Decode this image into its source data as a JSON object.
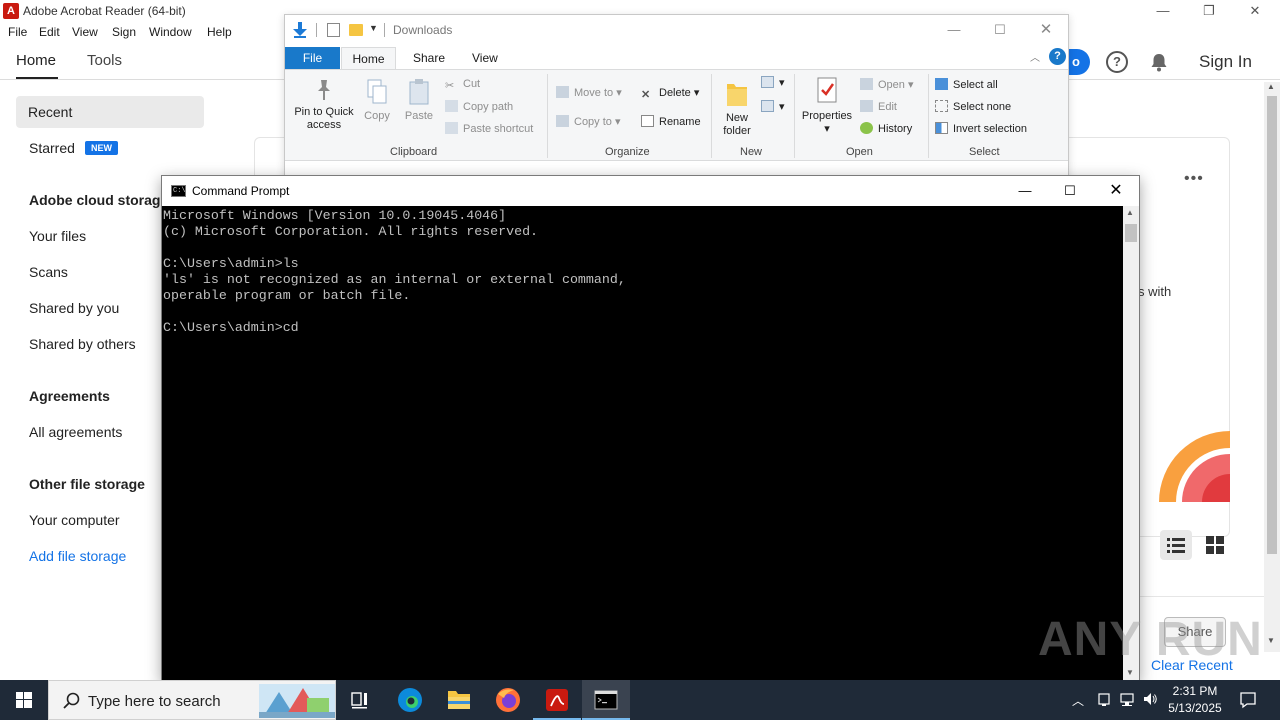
{
  "acrobat": {
    "title": "Adobe Acrobat Reader (64-bit)",
    "menu": [
      "File",
      "Edit",
      "View",
      "Sign",
      "Window",
      "Help"
    ],
    "tabs": {
      "home": "Home",
      "tools": "Tools"
    },
    "header": {
      "blue_button_fragment": "o",
      "help_glyph": "?",
      "sign_in": "Sign In"
    },
    "sidebar": {
      "recent": "Recent",
      "starred": "Starred",
      "new_badge": "NEW",
      "cloud_heading": "Adobe cloud storag",
      "your_files": "Your files",
      "scans": "Scans",
      "shared_by_you": "Shared by you",
      "shared_by_others": "Shared by others",
      "agreements_heading": "Agreements",
      "all_agreements": "All agreements",
      "other_heading": "Other file storage",
      "your_computer": "Your computer",
      "add_file_storage": "Add file storage"
    },
    "main": {
      "more": "•••",
      "with_fragment": "s with",
      "share": "Share",
      "clear_recent": "Clear Recent"
    },
    "colors": {
      "accent": "#1473e6",
      "brand_red": "#c91a10"
    }
  },
  "explorer": {
    "title": "Downloads",
    "tabs": {
      "file": "File",
      "home": "Home",
      "share": "Share",
      "view": "View"
    },
    "help_glyph": "?",
    "ribbon": {
      "clipboard": {
        "label": "Clipboard",
        "pin": "Pin to Quick access",
        "copy": "Copy",
        "paste": "Paste",
        "cut": "Cut",
        "copy_path": "Copy path",
        "paste_shortcut": "Paste shortcut"
      },
      "organize": {
        "label": "Organize",
        "move_to": "Move to",
        "copy_to": "Copy to",
        "delete": "Delete",
        "rename": "Rename"
      },
      "new": {
        "label": "New",
        "new_folder": "New folder"
      },
      "open": {
        "label": "Open",
        "properties": "Properties",
        "open": "Open",
        "edit": "Edit",
        "history": "History"
      },
      "select": {
        "label": "Select",
        "select_all": "Select all",
        "select_none": "Select none",
        "invert": "Invert selection"
      }
    }
  },
  "cmd": {
    "title": "Command Prompt",
    "icon_glyph": "C:\\",
    "output": "Microsoft Windows [Version 10.0.19045.4046]\n(c) Microsoft Corporation. All rights reserved.\n\nC:\\Users\\admin>ls\n'ls' is not recognized as an internal or external command,\noperable program or batch file.\n\nC:\\Users\\admin>cd"
  },
  "watermark": "ANY RUN",
  "taskbar": {
    "search_placeholder": "Type here to search",
    "time": "2:31 PM",
    "date": "5/13/2025"
  },
  "window_controls": {
    "minimize": "—",
    "maximize": "☐",
    "restore": "❐",
    "close": "✕"
  }
}
